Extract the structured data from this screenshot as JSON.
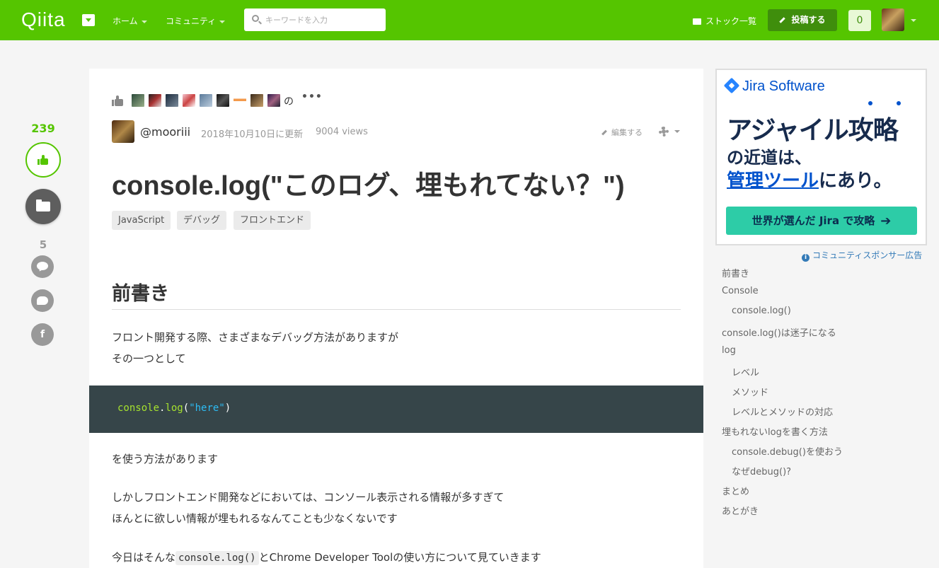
{
  "header": {
    "logo": "Qiita",
    "nav": [
      "ホーム",
      "コミュニティ"
    ],
    "search_placeholder": "キーワードを入力",
    "stock_list": "ストック一覧",
    "post_button": "投稿する",
    "notification_count": "0"
  },
  "rail": {
    "lgtm_count": "239",
    "comment_count": "5",
    "facebook_glyph": "f"
  },
  "article": {
    "likers_suffix": "の",
    "likers_more": "•••",
    "author": "@mooriii",
    "updated": "2018年10月10日に更新",
    "views": "9004 views",
    "edit": "編集する",
    "title": "console.log(\"このログ、埋もれてない？\")",
    "tags": [
      "JavaScript",
      "デバッグ",
      "フロントエンド"
    ],
    "heading1": "前書き",
    "para1_line1": "フロント開発する際、さまざまなデバッグ方法がありますが",
    "para1_line2": "その一つとして",
    "code": {
      "fn": "console",
      "dot": ".",
      "method": "log",
      "open": "(",
      "str": "\"here\"",
      "close": ")"
    },
    "para2": "を使う方法があります",
    "para3_line1": "しかしフロントエンド開発などにおいては、コンソール表示される情報が多すぎて",
    "para3_line2": "ほんとに欲しい情報が埋もれるなんてことも少なくないです",
    "para4_pre": "今日はそんな",
    "para4_code": "console.log()",
    "para4_post": "とChrome Developer Toolの使い方について見ていきます"
  },
  "ad": {
    "brand": "Jira Software",
    "headline1": "アジャイル攻略",
    "headline2": "の近道は、",
    "headline3_hl": "管理ツール",
    "headline3_rest": "にあり。",
    "cta": "世界が選んだ Jira で攻略",
    "cta_arrow": "➔",
    "sponsor": "コミュニティスポンサー広告",
    "info_glyph": "i"
  },
  "toc": [
    "前書き",
    "Console",
    "console.log()",
    "console.log()は迷子になる",
    "log",
    "レベル",
    "メソッド",
    "レベルとメソッドの対応",
    "埋もれないlogを書く方法",
    "console.debug()を使おう",
    "なぜdebug()?",
    "まとめ",
    "あとがき"
  ],
  "colors": {
    "brand_green": "#55c500",
    "code_bg": "#364549",
    "ad_cta": "#2dcca7",
    "jira_blue": "#0052cc"
  }
}
